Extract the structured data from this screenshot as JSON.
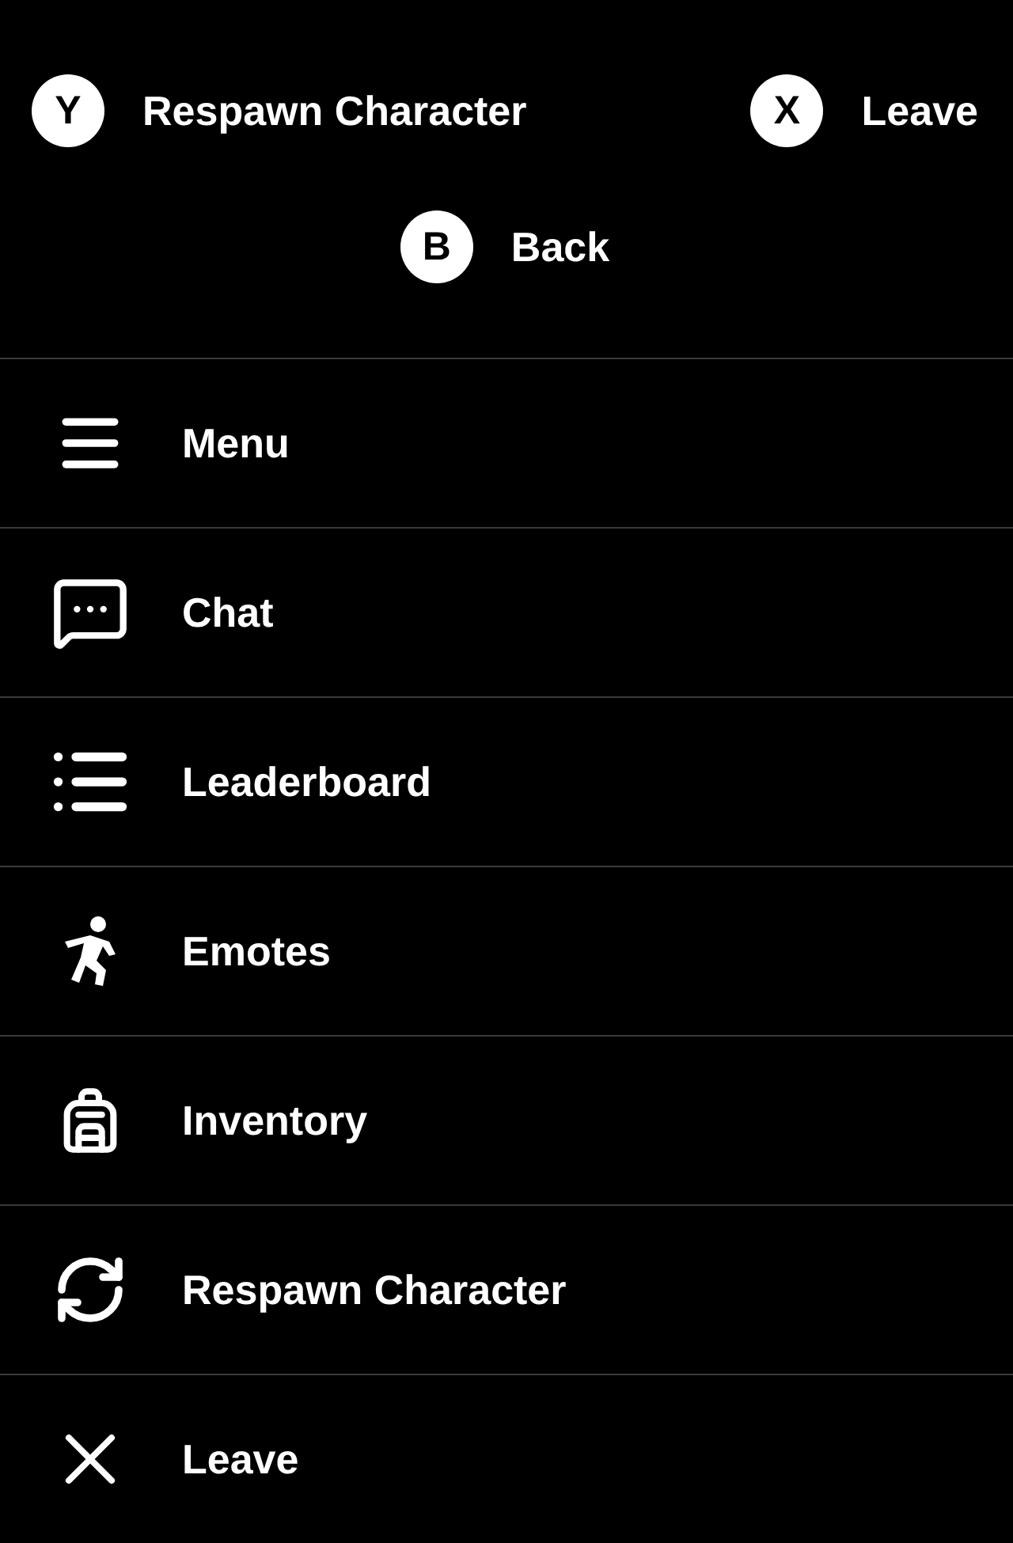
{
  "hints_top": [
    {
      "key": "Y",
      "label": "Respawn Character"
    },
    {
      "key": "X",
      "label": "Leave"
    }
  ],
  "hints_bottom": [
    {
      "key": "B",
      "label": "Back"
    }
  ],
  "menu_items": [
    {
      "label": "Menu"
    },
    {
      "label": "Chat"
    },
    {
      "label": "Leaderboard"
    },
    {
      "label": "Emotes"
    },
    {
      "label": "Inventory"
    },
    {
      "label": "Respawn Character"
    },
    {
      "label": "Leave"
    }
  ]
}
